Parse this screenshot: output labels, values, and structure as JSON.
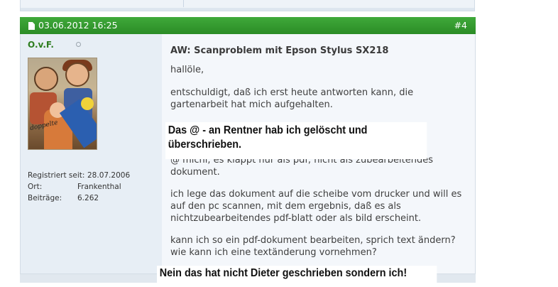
{
  "post": {
    "date": "03.06.2012 16:25",
    "number": "#4",
    "icon": "document-icon",
    "header_color": "#2e9128"
  },
  "user": {
    "name": "O.v.F.",
    "status_icon": "offline-dot-icon",
    "avatar_caption": "doppelte",
    "stats": [
      {
        "label": "Registriert seit:",
        "value": "28.07.2006"
      },
      {
        "label": "Ort:",
        "value": "Frankenthal"
      },
      {
        "label": "Beiträge:",
        "value": "6.262"
      }
    ]
  },
  "message": {
    "title": "AW: Scanproblem mit Epson Stylus SX218",
    "lines": [
      "hallöle,",
      "entschuldigt, daß ich erst heute antworten kann, die",
      "gartenarbeit hat mich aufgehalten.",
      "@ michi, es klappt nur als pdf, nicht als zubearbeitendes",
      "dokument.",
      "ich lege das dokument auf die scheibe vom drucker und will es",
      "auf den pc scannen, mit dem ergebnis, daß es als",
      "nichtzubearbeitendes pdf-blatt oder als bild erscheint.",
      "kann ich so ein pdf-dokument bearbeiten, sprich text ändern?",
      "wie kann ich eine textänderung vornehmen?"
    ]
  },
  "annotations": {
    "note1_line1": "Das @ - an Rentner hab ich gelöscht und",
    "note1_line2": "überschrieben.",
    "note2": "Nein das hat nicht Dieter geschrieben sondern ich!"
  }
}
